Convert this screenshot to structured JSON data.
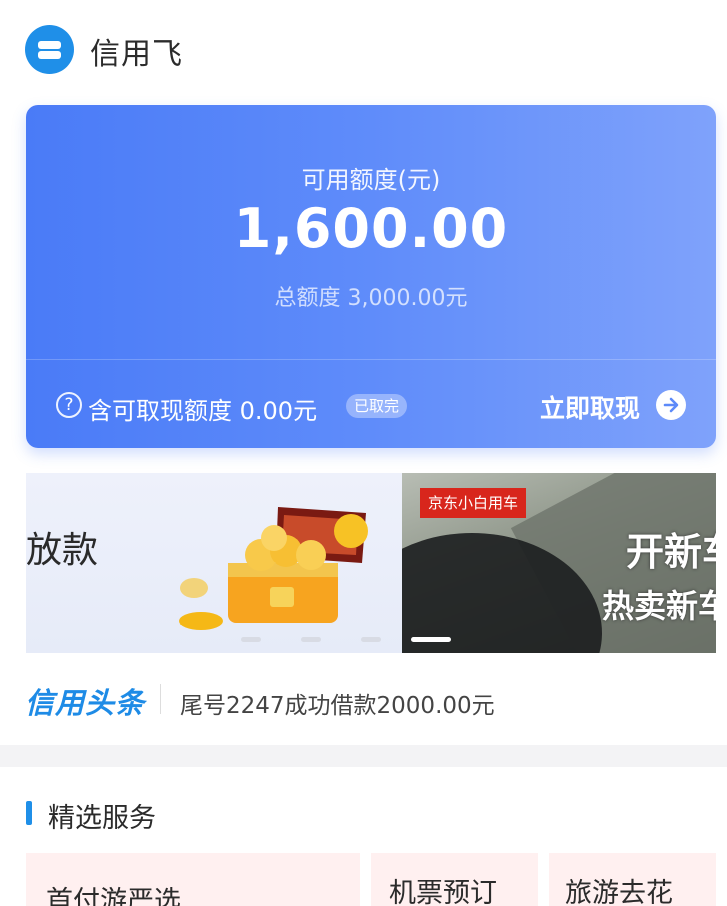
{
  "header": {
    "app_title": "信用飞",
    "logo_icon": "card-icon"
  },
  "credit": {
    "available_label": "可用额度(元)",
    "available_amount": "1,600.00",
    "total_label": "总额度 3,000.00元",
    "cash_label": "含可取现额度 0.00元",
    "cash_badge": "已取完",
    "withdraw_label": "立即取现",
    "help_icon": "question-circle-icon",
    "withdraw_icon": "arrow-right-circle-icon",
    "help_glyph": "?",
    "colors": {
      "card_gradient_start": "#4a7bf7",
      "card_gradient_end": "#7fa2fb"
    }
  },
  "banner": {
    "slide1_text": "放款",
    "slide2_tag": "京东小白用车",
    "slide2_title": "开新车",
    "slide2_subtitle": "热卖新车",
    "indicator_count": 4,
    "active_index": 3
  },
  "news": {
    "title": "信用头条",
    "text": "尾号2247成功借款2000.00元",
    "title_color": "#1e8be6"
  },
  "services": {
    "title": "精选服务",
    "items": [
      {
        "label": "首付游严选"
      },
      {
        "label": "机票预订"
      },
      {
        "label": "旅游去花"
      }
    ]
  }
}
